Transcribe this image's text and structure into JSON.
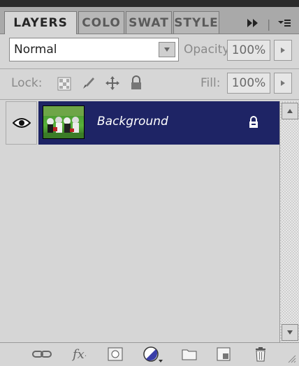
{
  "tabs": [
    {
      "label": "LAYERS"
    },
    {
      "label": "COLO"
    },
    {
      "label": "SWAT"
    },
    {
      "label": "STYLE"
    }
  ],
  "tab_controls": {
    "expand_icon": "double-arrow-icon",
    "menu_icon": "panel-menu-icon"
  },
  "blend_mode": {
    "value": "Normal"
  },
  "opacity": {
    "label": "Opacity:",
    "value": "100%"
  },
  "lock": {
    "label": "Lock:"
  },
  "fill": {
    "label": "Fill:",
    "value": "100%"
  },
  "layers": [
    {
      "name": "Background",
      "visible": true,
      "locked": true
    }
  ],
  "colors": {
    "selected_layer": "#1e2465",
    "panel": "#d6d6d6"
  },
  "bottom_toolbar": [
    "link-layers-icon",
    "fx-icon",
    "layer-mask-icon",
    "adjustment-layer-icon",
    "new-group-icon",
    "new-layer-icon",
    "trash-icon"
  ]
}
